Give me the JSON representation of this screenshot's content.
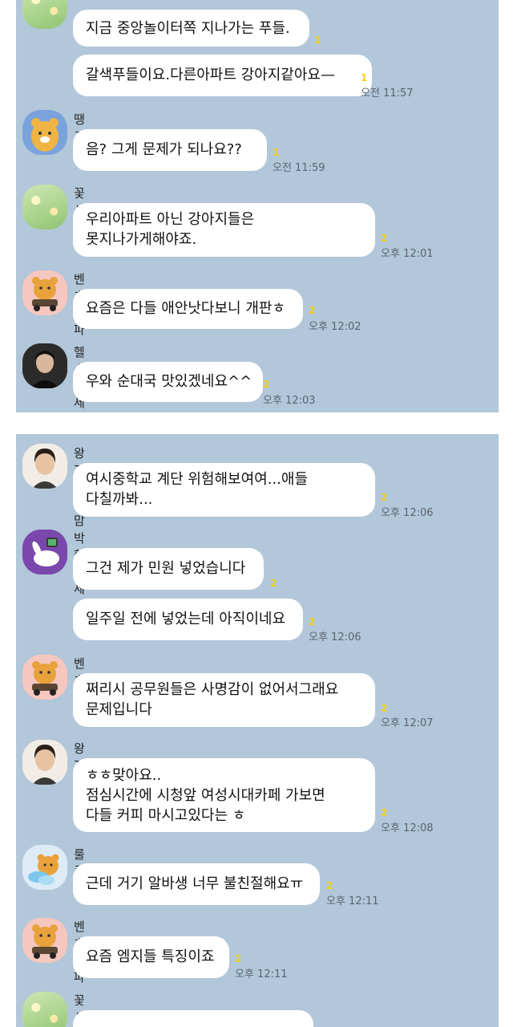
{
  "panel1": {
    "messages": [
      {
        "text": "지금 중앙놀이터쪽 지나가는 푸들.",
        "unread": "1"
      },
      {
        "text": "갈색푸들이요.다른아파트 강아지같아요—",
        "unread": "1",
        "time": "오전 11:57"
      },
      {
        "sender": "땡그리",
        "avatar": "ryan-icon",
        "text": "음? 그게 문제가 되나요??",
        "unread": "1",
        "time": "오전 11:59"
      },
      {
        "sender": "꽃사랑",
        "avatar": "flower-photo-icon",
        "text": "우리아파트 아닌 강아지들은\n못지나가게해야죠.",
        "unread": "2",
        "time": "오후 12:01"
      },
      {
        "sender": "벤츠파파",
        "avatar": "ryan-car-icon",
        "text": "요즘은 다들 애안낫다보니 개판ㅎ",
        "unread": "2",
        "time": "오후 12:02"
      },
      {
        "sender": "헬스하세요",
        "avatar": "person-photo-icon",
        "text": "우와 순대국 맛있겠네요^^",
        "unread": "2",
        "time": "오후 12:03"
      }
    ]
  },
  "panel2": {
    "messages": [
      {
        "sender": "왕자공주맘",
        "avatar": "woman-photo-icon",
        "text": "여시중학교 계단 위험해보여여...애들\n다칠까봐...",
        "unread": "2",
        "time": "오후 12:06"
      },
      {
        "sender": "박혁거세",
        "avatar": "bunny-tv-icon",
        "text": "그건 제가 민원 넣었습니다",
        "unread": "2"
      },
      {
        "text": "일주일 전에 넣었는데 아직이네요",
        "unread": "2",
        "time": "오후 12:06"
      },
      {
        "sender": "벤츠파파",
        "avatar": "ryan-car-icon",
        "text": "쩌리시 공무원들은 사명감이 없어서그래요\n문제입니다",
        "unread": "2",
        "time": "오후 12:07"
      },
      {
        "sender": "왕자공주맘",
        "avatar": "woman-photo-icon",
        "text": "ㅎㅎ맞아요..\n점심시간에 시청앞 여성시대카페 가보면\n다들 커피 마시고있다는 ㅎ",
        "unread": "2",
        "time": "오후 12:08"
      },
      {
        "sender": "룰루",
        "avatar": "ryan-cloud-icon",
        "text": "근데 거기 알바생 너무 불친절해요ㅠ",
        "unread": "2",
        "time": "오후 12:11"
      },
      {
        "sender": "벤츠파파",
        "avatar": "ryan-car-icon",
        "text": "요즘 엠지들 특징이죠",
        "unread": "2",
        "time": "오후 12:11"
      },
      {
        "sender": "꽃사랑",
        "avatar": "flower-photo-icon"
      }
    ]
  },
  "colors": {
    "chat_background": "#b2c7d9",
    "bubble": "#ffffff",
    "unread": "#f2d21a"
  }
}
